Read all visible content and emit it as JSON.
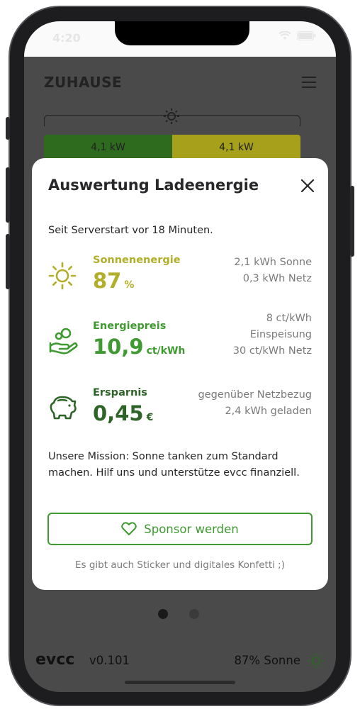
{
  "status": {
    "time": "4:20"
  },
  "header": {
    "title": "ZUHAUSE"
  },
  "energy_flow": {
    "segments": [
      "4,1 kW",
      "4,1 kW"
    ]
  },
  "modal": {
    "title": "Auswertung Ladeenergie",
    "since": "Seit Serverstart vor 18 Minuten.",
    "metrics": [
      {
        "label": "Sonnenenergie",
        "value": "87",
        "unit": "%",
        "right": [
          "2,1 kWh Sonne",
          "0,3 kWh Netz"
        ],
        "icon": "sun-icon",
        "color": "#b3ae2a"
      },
      {
        "label": "Energiepreis",
        "value": "10,9",
        "unit": "ct/kWh",
        "right": [
          "8 ct/kWh",
          "Einspeisung",
          "30 ct/kWh Netz"
        ],
        "icon": "hand-coins-icon",
        "color": "#3f9a31"
      },
      {
        "label": "Ersparnis",
        "value": "0,45",
        "unit": "€",
        "right": [
          "gegenüber Netzbezug",
          "2,4 kWh geladen"
        ],
        "icon": "piggy-bank-icon",
        "color": "#2e6428"
      }
    ],
    "mission": "Unsere Mission: Sonne tanken zum Standard machen. Hilf uns und unterstütze evcc finanziell.",
    "sponsor_label": "Sponsor werden",
    "sticker_text": "Es gibt auch Sticker und digitales Konfetti ;)"
  },
  "pagination": {
    "pages": 2,
    "active": 1
  },
  "footer": {
    "logo": "evcc",
    "version": "v0.101",
    "sun_status": "87% Sonne"
  }
}
